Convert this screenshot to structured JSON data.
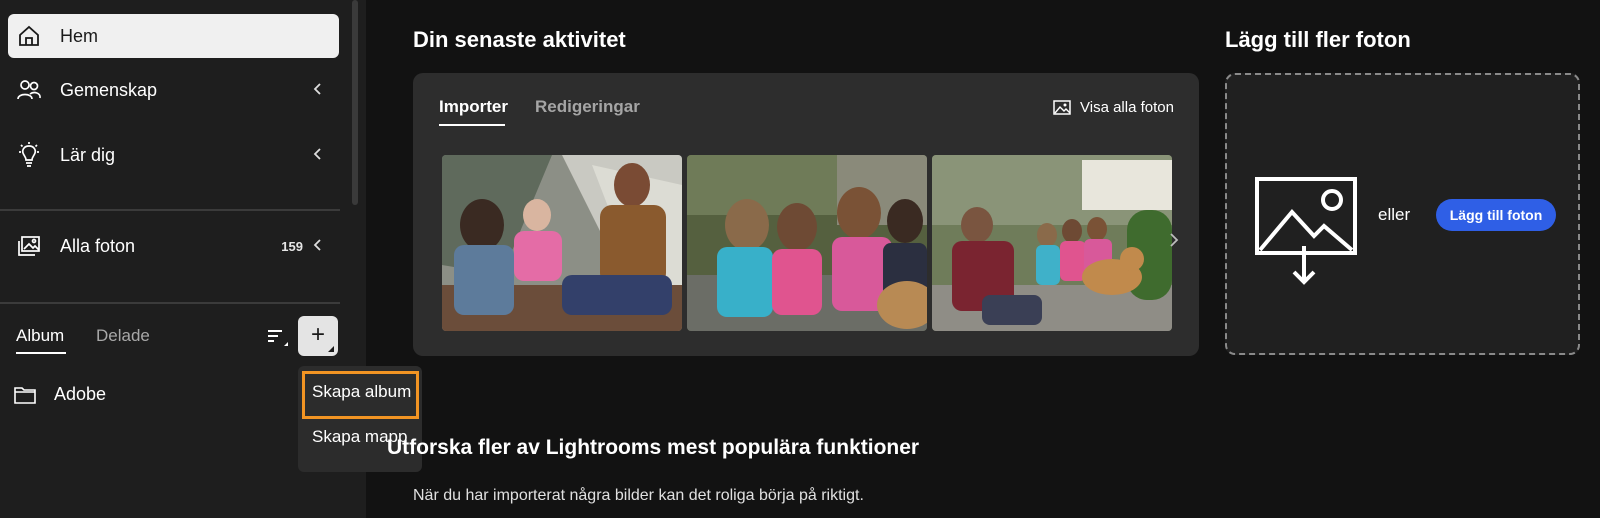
{
  "sidebar": {
    "nav": [
      {
        "label": "Hem",
        "icon": "home-icon",
        "active": true
      },
      {
        "label": "Gemenskap",
        "icon": "community-icon"
      },
      {
        "label": "Lär dig",
        "icon": "lightbulb-icon"
      }
    ],
    "all_photos": {
      "label": "Alla foton",
      "count": "159",
      "icon": "photos-icon"
    },
    "album_tabs": {
      "album": "Album",
      "shared": "Delade"
    },
    "folders": [
      {
        "label": "Adobe",
        "icon": "folder-icon"
      }
    ]
  },
  "context_menu": {
    "items": [
      "Skapa album",
      "Skapa mapp"
    ],
    "highlighted_index": 0
  },
  "recent": {
    "title": "Din senaste aktivitet",
    "tabs": [
      "Importer",
      "Redigeringar"
    ],
    "active_tab": "Importer",
    "view_all": "Visa alla foton"
  },
  "add_photos": {
    "title": "Lägg till fler foton",
    "or": "eller",
    "button": "Lägg till foton"
  },
  "explore": {
    "title": "Utforska fler av Lightrooms mest populära funktioner",
    "description": "När du har importerat några bilder kan det roliga börja på riktigt."
  },
  "colors": {
    "accent_blue": "#2f5fe6",
    "highlight_orange": "#f29423",
    "background": "#121212",
    "sidebar": "#1e1e1e"
  }
}
